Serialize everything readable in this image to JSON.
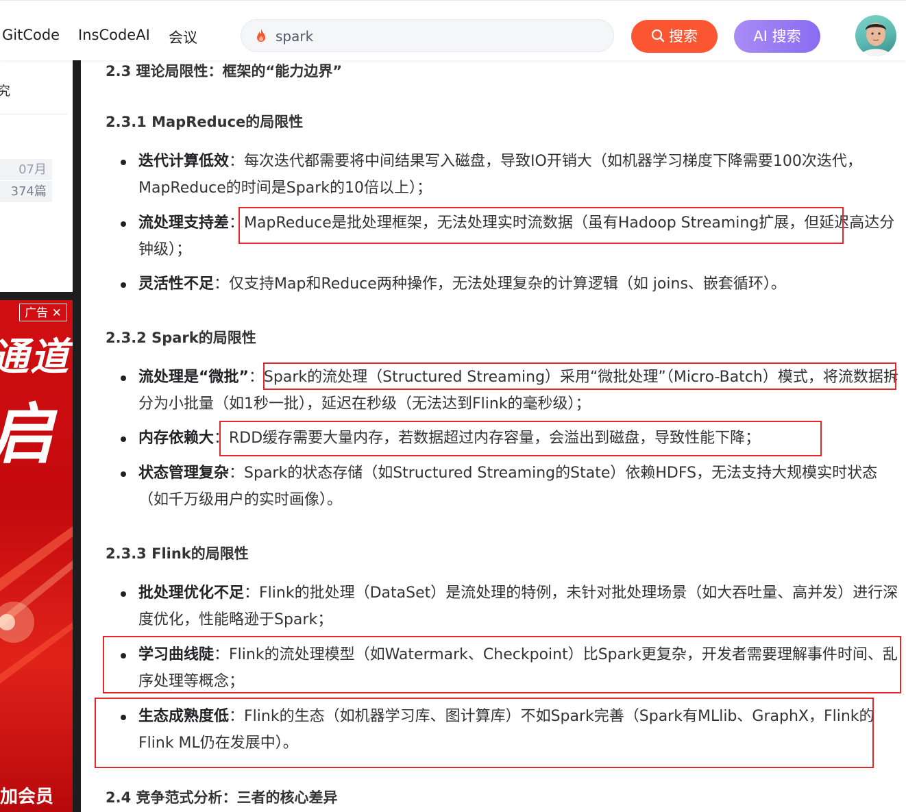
{
  "nav": {
    "links": [
      "GitCode",
      "InsCodeAI",
      "会议"
    ],
    "search_value": "spark",
    "search_button": "搜索",
    "ai_search_button": "AI 搜索"
  },
  "sidebar": {
    "card_text": "究",
    "date_pill": "07月",
    "count_pill": "374篇"
  },
  "ad": {
    "tag": "广告",
    "big_text_1": "通道",
    "big_text_2": "启",
    "bottom_text": "加会员"
  },
  "article": {
    "h_23": "2.3 理论局限性：框架的“能力边界”",
    "h_231": "2.3.1 MapReduce的局限性",
    "mr": [
      {
        "strong": "迭代计算低效",
        "text": "：每次迭代都需要将中间结果写入磁盘，导致IO开销大（如机器学习梯度下降需要100次迭代，MapReduce的时间是Spark的10倍以上）；"
      },
      {
        "strong": "流处理支持差",
        "text": "：MapReduce是批处理框架，无法处理实时流数据（虽有Hadoop Streaming扩展，但延迟高达分钟级）；"
      },
      {
        "strong": "灵活性不足",
        "text": "：仅支持Map和Reduce两种操作，无法处理复杂的计算逻辑（如 joins、嵌套循环）。"
      }
    ],
    "h_232": "2.3.2 Spark的局限性",
    "spark": [
      {
        "strong": "流处理是“微批”",
        "text": "：Spark的流处理（Structured Streaming）采用“微批处理”（Micro-Batch）模式，将流数据拆分为小批量（如1秒一批），延迟在秒级（无法达到Flink的毫秒级）；"
      },
      {
        "strong": "内存依赖大",
        "text": "：RDD缓存需要大量内存，若数据超过内存容量，会溢出到磁盘，导致性能下降；"
      },
      {
        "strong": "状态管理复杂",
        "text": "：Spark的状态存储（如Structured Streaming的State）依赖HDFS，无法支持大规模实时状态（如千万级用户的实时画像）。"
      }
    ],
    "h_233": "2.3.3 Flink的局限性",
    "flink": [
      {
        "strong": "批处理优化不足",
        "text": "：Flink的批处理（DataSet）是流处理的特例，未针对批处理场景（如大吞吐量、高并发）进行深度优化，性能略逊于Spark；"
      },
      {
        "strong": "学习曲线陡",
        "text": "：Flink的流处理模型（如Watermark、Checkpoint）比Spark更复杂，开发者需要理解事件时间、乱序处理等概念；"
      },
      {
        "strong": "生态成熟度低",
        "text": "：Flink的生态（如机器学习库、图计算库）不如Spark完善（Spark有MLlib、GraphX，Flink的Flink ML仍在发展中）。"
      }
    ],
    "h_24": "2.4 竞争范式分析：三者的核心差异"
  },
  "colors": {
    "accent_orange": "#fc5531",
    "ai_purple": "#8a6cf1",
    "annotation_red": "#e6262b"
  }
}
